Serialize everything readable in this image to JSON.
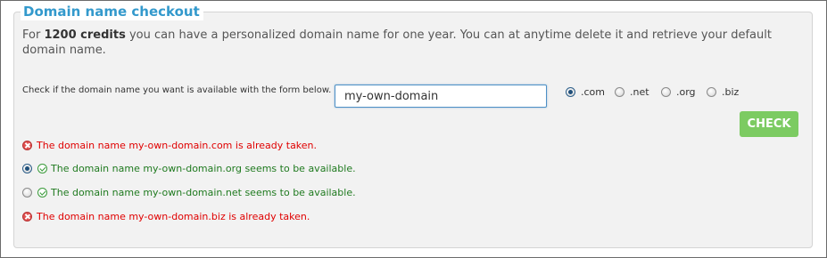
{
  "checkout": {
    "title": "Domain name checkout",
    "intro_prefix": "For ",
    "intro_credits": "1200 credits",
    "intro_suffix": " you can have a personalized domain name for one year. You can at anytime delete it and retrieve your default domain name.",
    "form_label": "Check if the domain name you want is available with the form below. :",
    "domain_value": "my-own-domain",
    "tlds": [
      {
        "label": ".com",
        "selected": true
      },
      {
        "label": ".net",
        "selected": false
      },
      {
        "label": ".org",
        "selected": false
      },
      {
        "label": ".biz",
        "selected": false
      }
    ],
    "check_label": "CHECK"
  },
  "results": [
    {
      "status": "taken",
      "icon": "error-icon",
      "text": "The domain name my-own-domain.com is already taken."
    },
    {
      "status": "available",
      "icon": "check-circle-icon",
      "selected": true,
      "text": "The domain name my-own-domain.org seems to be available."
    },
    {
      "status": "available",
      "icon": "check-circle-icon",
      "selected": false,
      "text": "The domain name my-own-domain.net seems to be available."
    },
    {
      "status": "taken",
      "icon": "error-icon",
      "text": "The domain name my-own-domain.biz is already taken."
    }
  ],
  "colors": {
    "title": "#3399cc",
    "button": "#7ccb62",
    "error": "#e00000",
    "success": "#1f7a1f"
  }
}
